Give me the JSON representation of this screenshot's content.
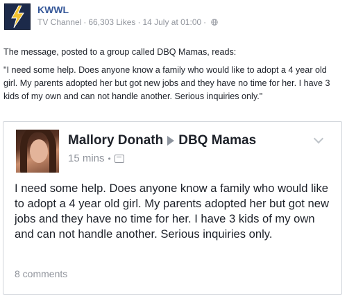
{
  "post": {
    "page_name": "KWWL",
    "category": "TV Channel",
    "likes": "66,303 Likes",
    "date": "14 July at 01:00",
    "privacy_icon": "globe-icon",
    "caption_intro": "The message, posted to a group called DBQ Mamas, reads:",
    "caption_quote": "\"I need some help. Does anyone know a family who would like to adopt a 4 year old girl. My parents adopted her but got new jobs and they have no time for her. I have 3 kids of my own and can not handle another. Serious inquiries only.\""
  },
  "embedded": {
    "author": "Mallory Donath",
    "group": "DBQ Mamas",
    "time": "15 mins",
    "audience_icon": "group-icon",
    "body": "I need some help. Does anyone know a family who would like to adopt a 4 year old girl. My parents adopted her but got new jobs and they have no time for her. I have 3 kids of my own and can not handle another. Serious inquiries only.",
    "comments": "8 comments"
  },
  "colors": {
    "link_blue": "#365899",
    "meta_gray": "#90949c",
    "text": "#1d2129"
  }
}
